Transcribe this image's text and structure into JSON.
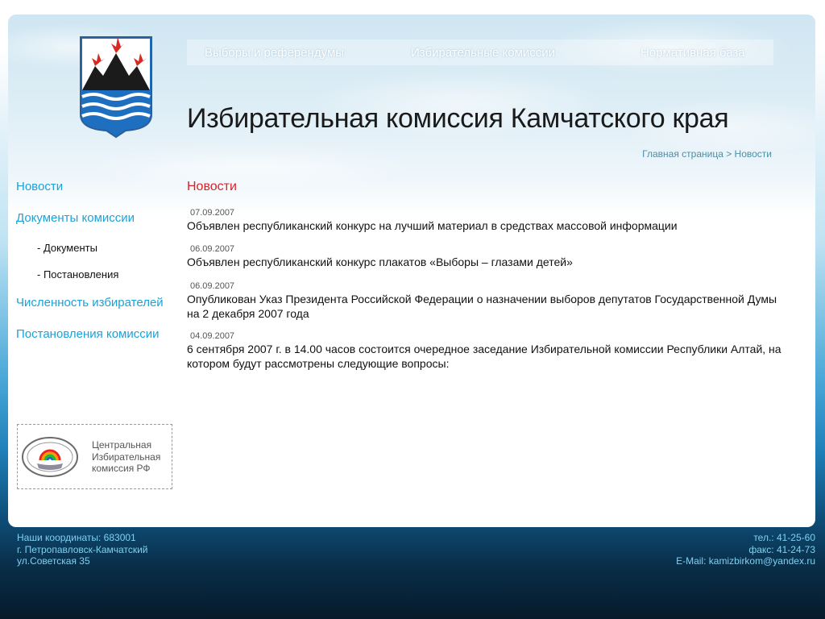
{
  "header": {
    "nav": [
      {
        "label": "Выборы и референдумы"
      },
      {
        "label": "Избирательные комиссии"
      },
      {
        "label": "Нормативная база"
      }
    ],
    "site_title": "Избирательная комиссия Камчатского края",
    "breadcrumb": "Главная страница > Новости"
  },
  "sidebar": {
    "items": [
      {
        "label": "Новости"
      },
      {
        "label": "Документы комиссии"
      },
      {
        "label": "- Документы"
      },
      {
        "label": "- Постановления"
      },
      {
        "label": "Численность избирателей"
      },
      {
        "label": "Постановления комиссии"
      }
    ],
    "cec_banner": {
      "line1": "Центральная",
      "line2": "Избирательная",
      "line3": "комиссия РФ"
    }
  },
  "main": {
    "section_title": "Новости",
    "news": [
      {
        "date": "07.09.2007",
        "title": "Объявлен республиканский конкурс на лучший материал в средствах массовой информации"
      },
      {
        "date": "06.09.2007",
        "title": "Объявлен республиканский конкурс плакатов «Выборы – глазами детей»"
      },
      {
        "date": "06.09.2007",
        "title": "Опубликован Указ Президента Российской Федерации о назначении выборов депутатов Государственной Думы на 2 декабря 2007 года"
      },
      {
        "date": "04.09.2007",
        "title": "6 сентября 2007 г. в 14.00 часов состоится очередное заседание Избирательной комиссии Республики Алтай, на котором будут рассмотрены следующие вопросы:"
      }
    ]
  },
  "footer": {
    "address_line1": "Наши координаты: 683001",
    "address_line2": "г. Петропавловск-Камчатский",
    "address_line3": "ул.Советская 35",
    "phone": "тел.: 41-25-60",
    "fax": "факс: 41-24-73",
    "email": "E-Mail: kamizbirkom@yandex.ru"
  },
  "colors": {
    "accent_link": "#1ba2d8",
    "section_title": "#d8232a",
    "footer_text": "#7fd0f0"
  }
}
